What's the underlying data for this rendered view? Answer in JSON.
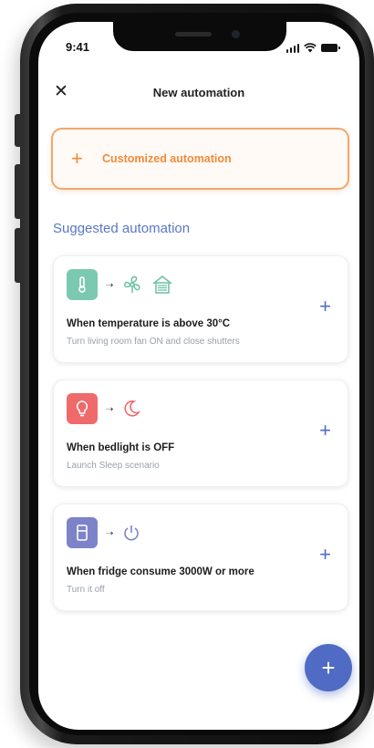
{
  "status_bar": {
    "time": "9:41"
  },
  "header": {
    "close_icon": "close-icon",
    "title": "New automation"
  },
  "custom_button": {
    "icon": "plus-icon",
    "label": "Customized automation"
  },
  "section": {
    "title": "Suggested automation"
  },
  "cards": [
    {
      "trigger_icon": "thermometer-icon",
      "action_icons": [
        "fan-icon",
        "house-shutter-icon"
      ],
      "title": "When temperature is above 30°C",
      "subtitle": "Turn living room fan ON and close shutters"
    },
    {
      "trigger_icon": "lightbulb-icon",
      "action_icons": [
        "moon-icon"
      ],
      "title": "When bedlight is OFF",
      "subtitle": "Launch Sleep scenario"
    },
    {
      "trigger_icon": "fridge-icon",
      "action_icons": [
        "power-icon"
      ],
      "title": "When fridge consume 3000W or more",
      "subtitle": "Turn it off"
    }
  ],
  "colors": {
    "accent_orange": "#f08a3c",
    "accent_blue": "#4f6bc3",
    "green": "#7cc9b1",
    "red": "#ef6b6b",
    "purple": "#7d83c9"
  }
}
